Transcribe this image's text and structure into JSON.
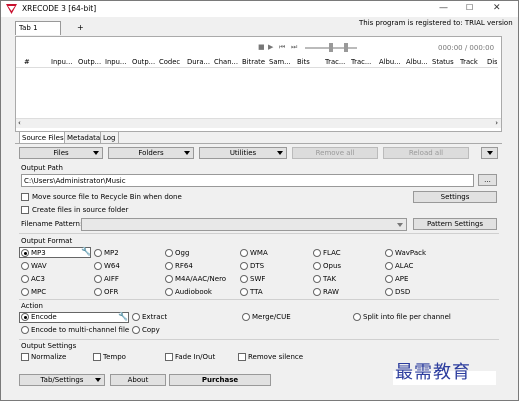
{
  "window": {
    "title": "XRECODE 3 [64-bit]"
  },
  "tabs": {
    "tab1": "Tab 1",
    "add": "+"
  },
  "registration": "This program is registered to: TRIAL version",
  "player": {
    "time": "000:00 / 000:00"
  },
  "columns": [
    "#",
    "Inpu...",
    "Outp...",
    "Inpu...",
    "Outp...",
    "Codec",
    "Dura...",
    "Chan...",
    "Bitrate",
    "Sam...",
    "Bits",
    "Trac...",
    "Trac...",
    "Albu...",
    "Albu...",
    "Status",
    "Track",
    "Dis"
  ],
  "subtabs": [
    "Source Files",
    "Metadata",
    "Log"
  ],
  "toolbar": {
    "files": "Files",
    "folders": "Folders",
    "utilities": "Utilities",
    "remove_all": "Remove all",
    "reload_all": "Reload all"
  },
  "output_path": {
    "label": "Output Path",
    "value": "C:\\Users\\Administrator\\Music",
    "browse": "...",
    "settings": "Settings",
    "move_source": "Move source file to Recycle Bin when done",
    "create_files": "Create files in source folder",
    "filename_label": "Filename Pattern:",
    "pattern_settings": "Pattern Settings"
  },
  "output_format": {
    "label": "Output Format",
    "items": [
      "MP3",
      "MP2",
      "Ogg",
      "WMA",
      "FLAC",
      "WavPack",
      "WAV",
      "W64",
      "RF64",
      "DTS",
      "Opus",
      "ALAC",
      "AC3",
      "AIFF",
      "M4A/AAC/Nero",
      "SWF",
      "TAK",
      "APE",
      "MPC",
      "OFR",
      "Audiobook",
      "TTA",
      "RAW",
      "DSD"
    ]
  },
  "action": {
    "label": "Action",
    "encode": "Encode",
    "extract": "Extract",
    "merge": "Merge/CUE",
    "split": "Split into file per channel",
    "multichannel": "Encode to multi-channel file",
    "copy": "Copy"
  },
  "output_settings": {
    "label": "Output Settings",
    "normalize": "Normalize",
    "tempo": "Tempo",
    "fade": "Fade In/Out",
    "silence": "Remove silence"
  },
  "bottom": {
    "tab_settings": "Tab/Settings",
    "about": "About",
    "purchase": "Purchase"
  },
  "watermark": "最需教育"
}
